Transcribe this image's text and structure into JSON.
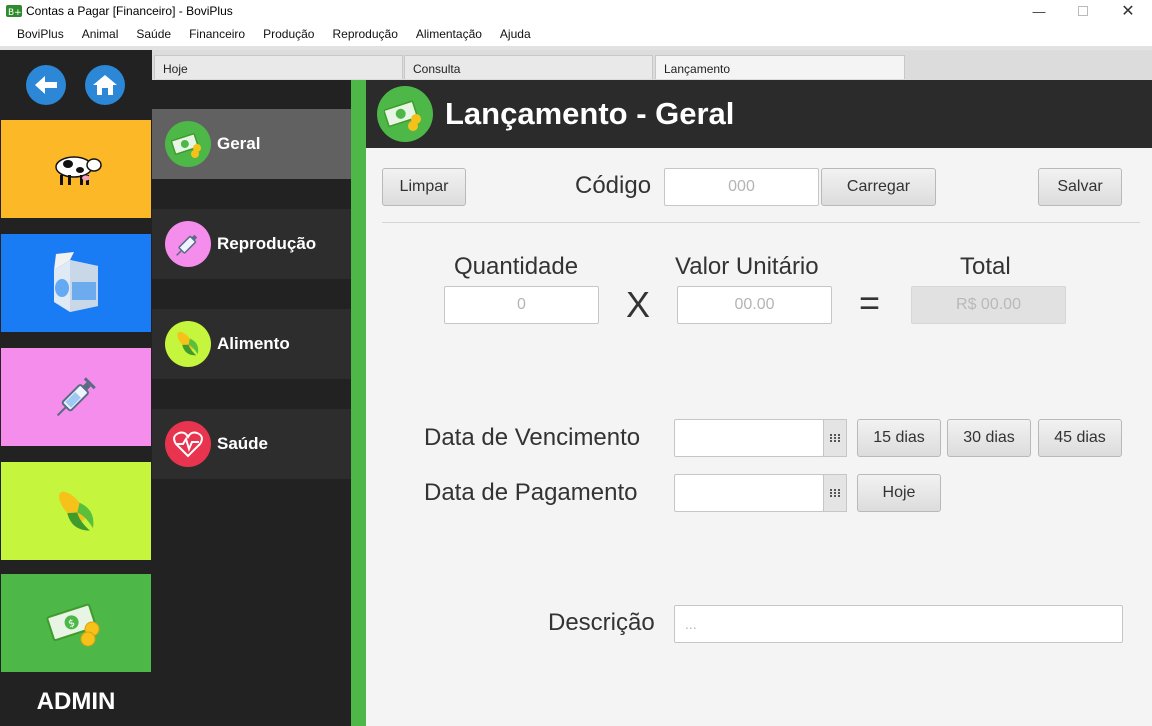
{
  "window": {
    "title": "Contas a Pagar [Financeiro] - BoviPlus"
  },
  "menu": [
    "BoviPlus",
    "Animal",
    "Saúde",
    "Financeiro",
    "Produção",
    "Reprodução",
    "Alimentação",
    "Ajuda"
  ],
  "tabs": [
    "Hoje",
    "Consulta",
    "Lançamento"
  ],
  "active_tab": "Lançamento",
  "left_rail": {
    "tiles": [
      {
        "icon": "cow-icon",
        "color": "#fdb827"
      },
      {
        "icon": "milk-carton-icon",
        "color": "#1a7cf5"
      },
      {
        "icon": "syringe-icon",
        "color": "#f58ded"
      },
      {
        "icon": "corn-icon",
        "color": "#c5f53c"
      },
      {
        "icon": "money-icon",
        "color": "#4db848"
      }
    ],
    "user": "ADMIN"
  },
  "submenu": [
    {
      "label": "Geral",
      "icon": "money-icon",
      "icon_bg": "#4db848",
      "active": true
    },
    {
      "label": "Reprodução",
      "icon": "syringe-icon",
      "icon_bg": "#f58ded",
      "active": false
    },
    {
      "label": "Alimento",
      "icon": "corn-icon",
      "icon_bg": "#c5f53c",
      "active": false
    },
    {
      "label": "Saúde",
      "icon": "heart-pulse-icon",
      "icon_bg": "#e8344e",
      "active": false
    }
  ],
  "header": {
    "title": "Lançamento - Geral"
  },
  "form": {
    "limpar": "Limpar",
    "codigo_label": "Código",
    "codigo_placeholder": "000",
    "carregar": "Carregar",
    "salvar": "Salvar",
    "quantidade_label": "Quantidade",
    "quantidade_placeholder": "0",
    "times": "X",
    "valor_label": "Valor Unitário",
    "valor_placeholder": "00.00",
    "equals": "=",
    "total_label": "Total",
    "total_value": "R$ 00.00",
    "vencimento_label": "Data de Vencimento",
    "btn_15": "15 dias",
    "btn_30": "30 dias",
    "btn_45": "45 dias",
    "pagamento_label": "Data de Pagamento",
    "hoje": "Hoje",
    "descricao_label": "Descrição",
    "descricao_placeholder": "..."
  },
  "colors": {
    "accent_green": "#4db848",
    "dark_bg": "#222222"
  }
}
